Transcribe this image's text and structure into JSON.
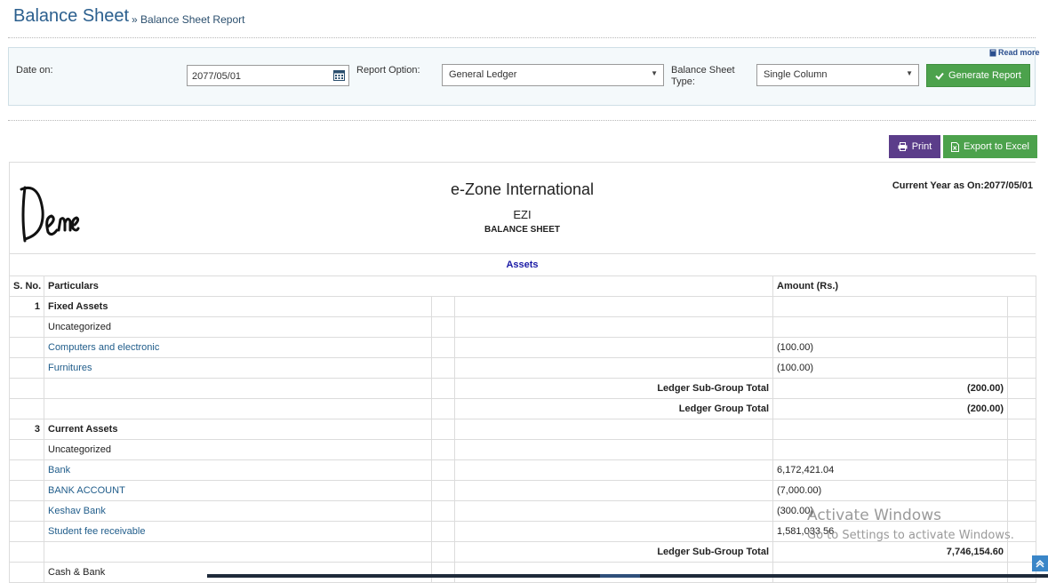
{
  "header": {
    "title": "Balance Sheet",
    "breadcrumb_separator": "»",
    "breadcrumb": "Balance Sheet Report"
  },
  "filters": {
    "read_more": "Read more",
    "date_label": "Date on:",
    "date_value": "2077/05/01",
    "report_option_label": "Report Option:",
    "report_option_value": "General Ledger",
    "type_label_line1": "Balance Sheet",
    "type_label_line2": "Type:",
    "type_value": "Single Column",
    "generate_label": "Generate Report"
  },
  "actions": {
    "print_label": "Print",
    "export_label": "Export to Excel"
  },
  "report": {
    "logo_text": "Demo",
    "company": "e-Zone International",
    "short_name": "EZI",
    "doc_title": "BALANCE SHEET",
    "current_year": "Current Year as On:2077/05/01",
    "section_title": "Assets",
    "columns": {
      "sn": "S. No.",
      "particulars": "Particulars",
      "amount": "Amount (Rs.)"
    },
    "rows": [
      {
        "sn": "1",
        "particulars": "Fixed Assets",
        "label": "",
        "amount": "",
        "kind": "group"
      },
      {
        "sn": "",
        "particulars": "Uncategorized",
        "label": "",
        "amount": "",
        "kind": "plain"
      },
      {
        "sn": "",
        "particulars": "Computers and electronic",
        "label": "",
        "amount": "(100.00)",
        "kind": "ledger"
      },
      {
        "sn": "",
        "particulars": "Furnitures",
        "label": "",
        "amount": "(100.00)",
        "kind": "ledger"
      },
      {
        "sn": "",
        "particulars": "",
        "label": "Ledger Sub-Group Total",
        "amount": "(200.00)",
        "kind": "total"
      },
      {
        "sn": "",
        "particulars": "",
        "label": "Ledger Group Total",
        "amount": "(200.00)",
        "kind": "total"
      },
      {
        "sn": "3",
        "particulars": "Current Assets",
        "label": "",
        "amount": "",
        "kind": "group"
      },
      {
        "sn": "",
        "particulars": "Uncategorized",
        "label": "",
        "amount": "",
        "kind": "plain"
      },
      {
        "sn": "",
        "particulars": "Bank",
        "label": "",
        "amount": "6,172,421.04",
        "kind": "ledger"
      },
      {
        "sn": "",
        "particulars": "BANK ACCOUNT",
        "label": "",
        "amount": "(7,000.00)",
        "kind": "ledger"
      },
      {
        "sn": "",
        "particulars": "Keshav Bank",
        "label": "",
        "amount": "(300.00)",
        "kind": "ledger"
      },
      {
        "sn": "",
        "particulars": "Student fee receivable",
        "label": "",
        "amount": "1,581,033.56",
        "kind": "ledger"
      },
      {
        "sn": "",
        "particulars": "",
        "label": "Ledger Sub-Group Total",
        "amount": "7,746,154.60",
        "kind": "total"
      },
      {
        "sn": "",
        "particulars": "Cash & Bank",
        "label": "",
        "amount": "",
        "kind": "plain"
      }
    ]
  },
  "watermark": {
    "line1": "Activate Windows",
    "line2": "Go to Settings to activate Windows."
  },
  "colors": {
    "title": "#2b5f8e",
    "link": "#1f5c8a",
    "print_button": "#5b3d8a",
    "green_button": "#4ca24c",
    "section_title": "#1a1aa6"
  },
  "icons": [
    "calendar-icon",
    "check-icon",
    "print-icon",
    "excel-icon",
    "book-icon",
    "scroll-top-icon"
  ]
}
